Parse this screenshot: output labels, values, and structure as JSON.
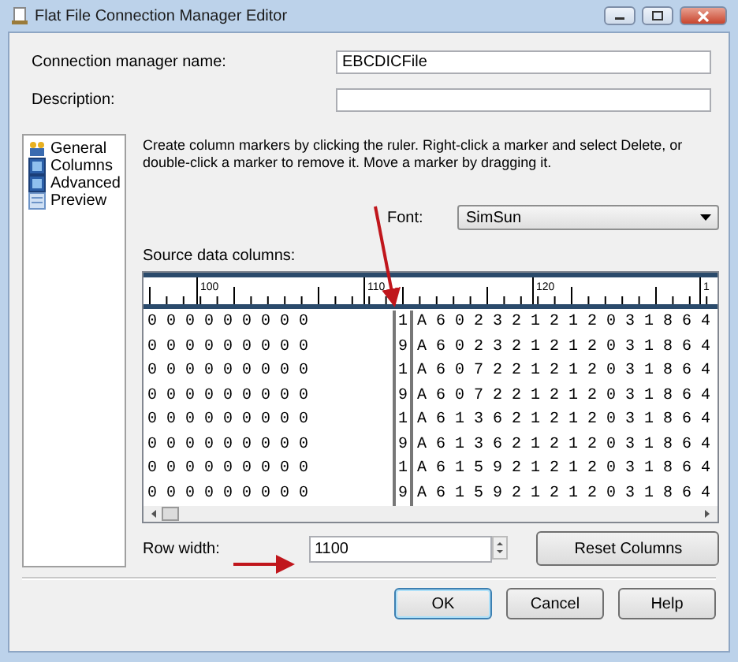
{
  "window": {
    "title": "Flat File Connection Manager Editor"
  },
  "fields": [
    {
      "label": "Connection manager name:",
      "value": "EBCDICFile"
    },
    {
      "label": "Description:"
    }
  ],
  "sidebar": {
    "items": [
      {
        "label": "General",
        "kind": "general"
      },
      {
        "label": "Columns",
        "kind": "grid"
      },
      {
        "label": "Advanced",
        "kind": "grid"
      },
      {
        "label": "Preview",
        "kind": "preview"
      }
    ]
  },
  "instructions": "Create column markers by clicking the ruler. Right-click a marker and select Delete, or double-click a marker to remove it. Move a marker by dragging it.",
  "font": {
    "label": "Font:",
    "value": "SimSun"
  },
  "source_columns": {
    "label": "Source data columns:",
    "ruler_labels": [
      "100",
      "110",
      "120",
      "1"
    ],
    "rows": [
      {
        "column_1": "0 0 0 0 0 0 0 0 0",
        "column_2": "1",
        "column_3": "A 6 0 2 3 2 1 2 1 2 0 3 1 8 6 4"
      },
      {
        "column_1": "0 0 0 0 0 0 0 0 0",
        "column_2": "9",
        "column_3": "A 6 0 2 3 2 1 2 1 2 0 3 1 8 6 4"
      },
      {
        "column_1": "0 0 0 0 0 0 0 0 0",
        "column_2": "1",
        "column_3": "A 6 0 7 2 2 1 2 1 2 0 3 1 8 6 4"
      },
      {
        "column_1": "0 0 0 0 0 0 0 0 0",
        "column_2": "9",
        "column_3": "A 6 0 7 2 2 1 2 1 2 0 3 1 8 6 4"
      },
      {
        "column_1": "0 0 0 0 0 0 0 0 0",
        "column_2": "1",
        "column_3": "A 6 1 3 6 2 1 2 1 2 0 3 1 8 6 4"
      },
      {
        "column_1": "0 0 0 0 0 0 0 0 0",
        "column_2": "9",
        "column_3": "A 6 1 3 6 2 1 2 1 2 0 3 1 8 6 4"
      },
      {
        "column_1": "0 0 0 0 0 0 0 0 0",
        "column_2": "1",
        "column_3": "A 6 1 5 9 2 1 2 1 2 0 3 1 8 6 4"
      },
      {
        "column_1": "0 0 0 0 0 0 0 0 0",
        "column_2": "9",
        "column_3": "A 6 1 5 9 2 1 2 1 2 0 3 1 8 6 4"
      }
    ]
  },
  "row_width": {
    "label": "Row width:",
    "value": "1100"
  },
  "reset_button": "Reset Columns",
  "buttons": [
    {
      "label": "OK",
      "default": true
    },
    {
      "label": "Cancel",
      "default": false
    },
    {
      "label": "Help",
      "default": false
    }
  ]
}
